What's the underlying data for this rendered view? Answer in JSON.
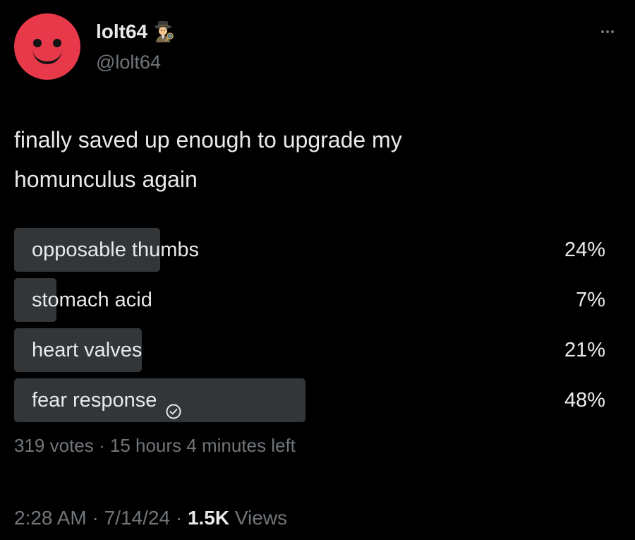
{
  "user": {
    "display_name": "lolt64",
    "handle": "@lolt64",
    "avatar_color": "#e8394a",
    "badge_icon": "detective-emoji-icon"
  },
  "tweet": {
    "text_line1": "finally saved up enough to upgrade my",
    "text_line2": "homunculus again"
  },
  "poll": {
    "options": [
      {
        "label": "opposable thumbs",
        "percent": "24%",
        "fraction": 0.24,
        "selected": false
      },
      {
        "label": "stomach acid",
        "percent": "7%",
        "fraction": 0.07,
        "selected": false
      },
      {
        "label": "heart valves",
        "percent": "21%",
        "fraction": 0.21,
        "selected": false
      },
      {
        "label": "fear response",
        "percent": "48%",
        "fraction": 0.48,
        "selected": true
      }
    ],
    "votes": "319 votes",
    "separator": " · ",
    "time_left": "15 hours 4 minutes left",
    "bar_color": "#333639"
  },
  "meta": {
    "time": "2:28 AM",
    "date": "7/14/24",
    "separator": " · ",
    "views_count": "1.5K",
    "views_label": " Views"
  },
  "colors": {
    "background": "#000000",
    "primary_text": "#e7e9ea",
    "secondary_text": "#71767b"
  }
}
